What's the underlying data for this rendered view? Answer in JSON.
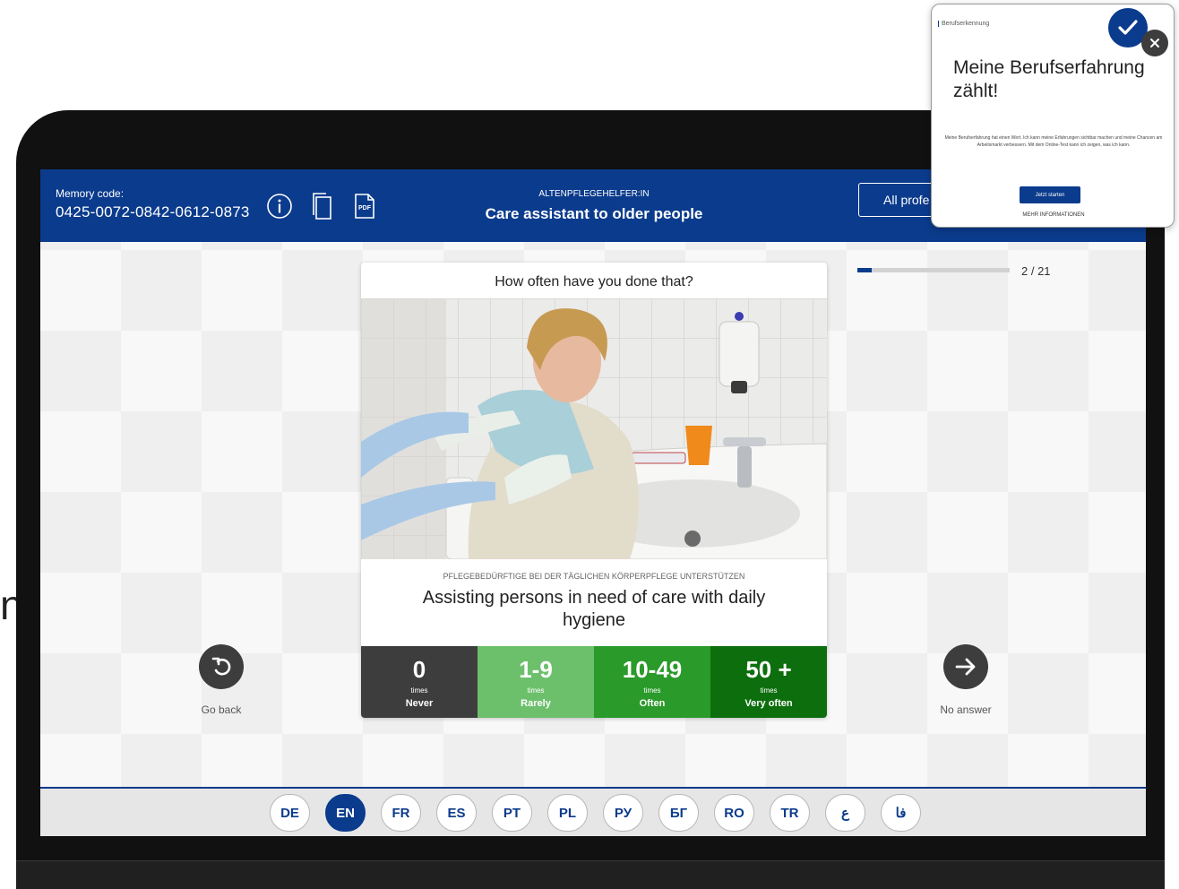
{
  "header": {
    "memory_label": "Memory code:",
    "memory_code": "0425-0072-0842-0612-0873",
    "icons": [
      "info-icon",
      "copy-icon",
      "pdf-icon"
    ],
    "pdf_icon_text": "PDF",
    "profession_small": "ALTENPFLEGEHELFER:IN",
    "profession_title": "Care assistant to older people",
    "all_professions_button": "All profe"
  },
  "progress": {
    "text": "2 / 21",
    "current": 2,
    "total": 21
  },
  "card": {
    "question": "How often have you done that?",
    "subtitle": "PFLEGEBEDÜRFTIGE BEI DER TÄGLICHEN KÖRPERPFLEGE UNTERSTÜTZEN",
    "title": "Assisting persons in need of care with daily hygiene",
    "options": [
      {
        "value": "0",
        "unit": "times",
        "label": "Never",
        "color": "#3d3d3d"
      },
      {
        "value": "1-9",
        "unit": "times",
        "label": "Rarely",
        "color": "#6cc06c"
      },
      {
        "value": "10-49",
        "unit": "times",
        "label": "Often",
        "color": "#2a9a2a"
      },
      {
        "value": "50 +",
        "unit": "times",
        "label": "Very often",
        "color": "#0d6e0d"
      }
    ]
  },
  "nav": {
    "back_label": "Go back",
    "back_icon": "undo-arrow-icon",
    "next_label": "No answer",
    "next_icon": "arrow-right-icon"
  },
  "languages": {
    "items": [
      "DE",
      "EN",
      "FR",
      "ES",
      "PT",
      "PL",
      "РУ",
      "БГ",
      "RO",
      "TR",
      "ع",
      "فا"
    ],
    "active": "EN"
  },
  "popup": {
    "top_text": "Berufserkennung",
    "title": "Meine Berufserfahrung zählt!",
    "body": "Meine Berufserfahrung hat einen Wert. Ich kann meine Erfahrungen sichtbar machen und meine Chancen am Arbeitsmarkt verbessern. Mit dem Online-Test kann ich zeigen, was ich kann.",
    "button": "Jetzt starten",
    "bottom": "MEHR INFORMATIONEN"
  },
  "colors": {
    "brand": "#0b3b8c",
    "never": "#3d3d3d",
    "rarely": "#6cc06c",
    "often": "#2a9a2a",
    "very_often": "#0d6e0d"
  },
  "stray_text": "n"
}
